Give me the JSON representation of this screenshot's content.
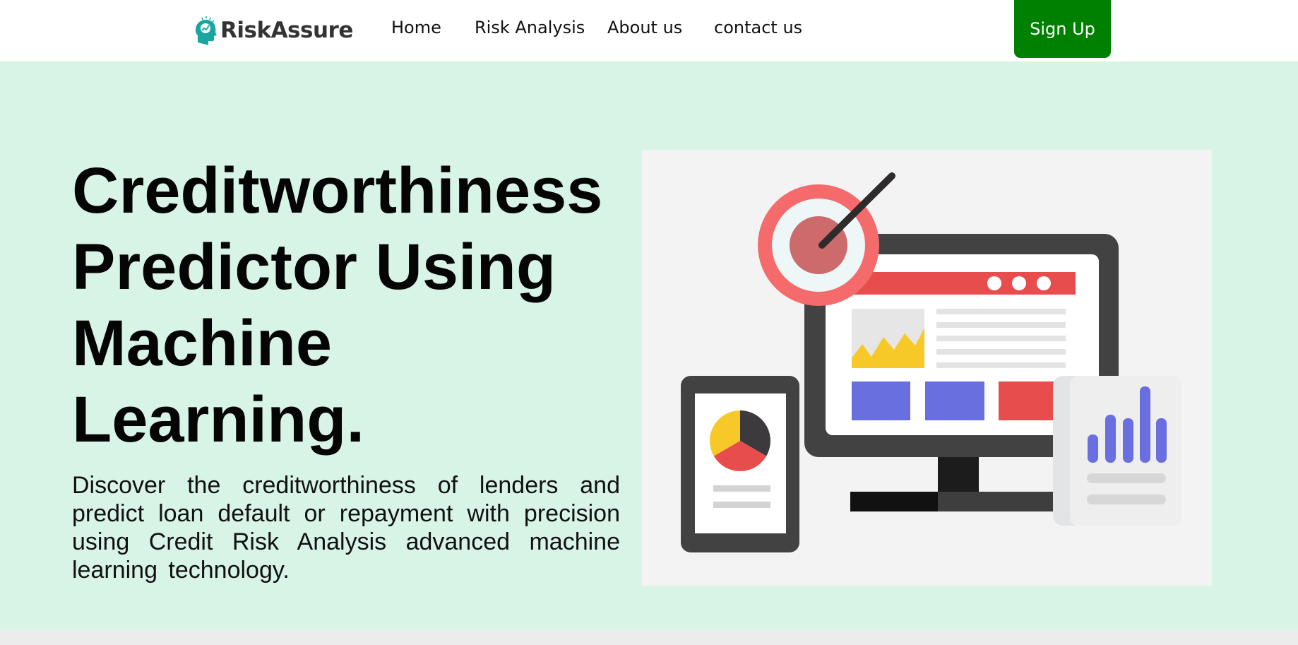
{
  "brand": {
    "name": "RiskAssure",
    "icon": "head-with-chart-icon"
  },
  "nav": {
    "items": [
      {
        "label": "Home"
      },
      {
        "label": "Risk Analysis"
      },
      {
        "label": "About us"
      },
      {
        "label": "contact us"
      }
    ],
    "signup_label": "Sign Up"
  },
  "hero": {
    "title": "Creditworthiness Predictor Using Machine Learning.",
    "description": "Discover the creditworthiness of lenders and predict loan default or repayment with precision using Credit Risk Analysis advanced machine learning technology."
  },
  "colors": {
    "brand_teal": "#1aa6a0",
    "signup_green": "#008000",
    "hero_bg": "#d8f4e7",
    "illustration_red": "#e84d4d",
    "illustration_blue": "#6a6fdf",
    "illustration_yellow": "#f7c928"
  }
}
